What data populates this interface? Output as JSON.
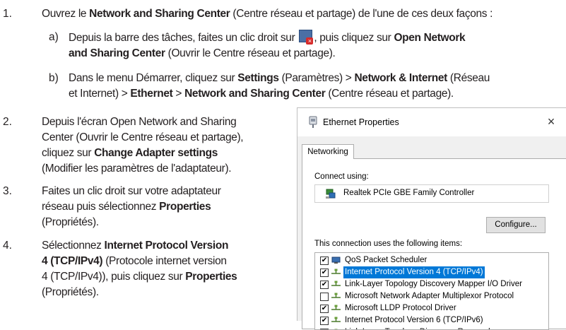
{
  "steps": {
    "s1": {
      "num": "1.",
      "t1": "Ouvrez le ",
      "b1": "Network and Sharing Center",
      "t2": " (Centre réseau et partage) de l'une de ces deux façons :"
    },
    "s1a": {
      "letter": "a)",
      "t1": "Depuis la barre des tâches, faites un clic droit sur ",
      "icon": "network-tray-icon",
      "t2": ", puis cliquez sur ",
      "b1": "Open Network",
      "b2": "and Sharing Center",
      "t3": " (Ouvrir le Centre réseau et partage)."
    },
    "s1b": {
      "letter": "b)",
      "t1": "Dans le menu Démarrer, cliquez sur ",
      "b1": "Settings",
      "t2": " (Paramètres) > ",
      "b2": "Network & Internet",
      "t3": " (Réseau",
      "t4": "et Internet) > ",
      "b3": "Ethernet",
      "t5": " > ",
      "b4": "Network and Sharing Center",
      "t6": " (Centre réseau et partage)."
    },
    "s2": {
      "num": "2.",
      "l1": "Depuis l'écran Open Network and Sharing",
      "l2": "Center (Ouvrir le Centre réseau et partage),",
      "l3a": "cliquez sur ",
      "l3b": "Change Adapter settings",
      "l4": "(Modifier les paramètres de l'adaptateur)."
    },
    "s3": {
      "num": "3.",
      "l1": "Faites un clic droit sur votre adaptateur",
      "l2a": "réseau puis sélectionnez ",
      "l2b": "Properties",
      "l3": "(Propriétés)."
    },
    "s4": {
      "num": "4.",
      "l1a": "Sélectionnez ",
      "l1b": "Internet Protocol Version",
      "l2a": "4 (TCP/IPv4)",
      "l2b": " (Protocole internet version",
      "l3a": "4 (TCP/IPv4)), puis cliquez sur ",
      "l3b": "Properties",
      "l4": "(Propriétés)."
    }
  },
  "dialog": {
    "title": "Ethernet Properties",
    "title_icon": "ethernet-icon",
    "close": "×",
    "tab": "Networking",
    "connect_using": "Connect using:",
    "adapter": "Realtek PCIe GBE Family Controller",
    "configure": "Configure...",
    "items_label": "This connection uses the following items:",
    "items": [
      {
        "checked": true,
        "icon": "qos-icon",
        "label": "QoS Packet Scheduler",
        "selected": false
      },
      {
        "checked": true,
        "icon": "protocol-icon",
        "label": "Internet Protocol Version 4 (TCP/IPv4)",
        "selected": true
      },
      {
        "checked": true,
        "icon": "protocol-icon",
        "label": "Link-Layer Topology Discovery Mapper I/O Driver",
        "selected": false
      },
      {
        "checked": false,
        "icon": "protocol-icon",
        "label": "Microsoft Network Adapter Multiplexor Protocol",
        "selected": false
      },
      {
        "checked": true,
        "icon": "protocol-icon",
        "label": "Microsoft LLDP Protocol Driver",
        "selected": false
      },
      {
        "checked": true,
        "icon": "protocol-icon",
        "label": "Internet Protocol Version 6 (TCP/IPv6)",
        "selected": false
      },
      {
        "checked": true,
        "icon": "protocol-icon",
        "label": "Link-Layer Topology Discovery Responder",
        "selected": false
      }
    ]
  },
  "colors": {
    "text": "#231f20",
    "selection": "#0078d7",
    "panel": "#f0f0f0"
  }
}
